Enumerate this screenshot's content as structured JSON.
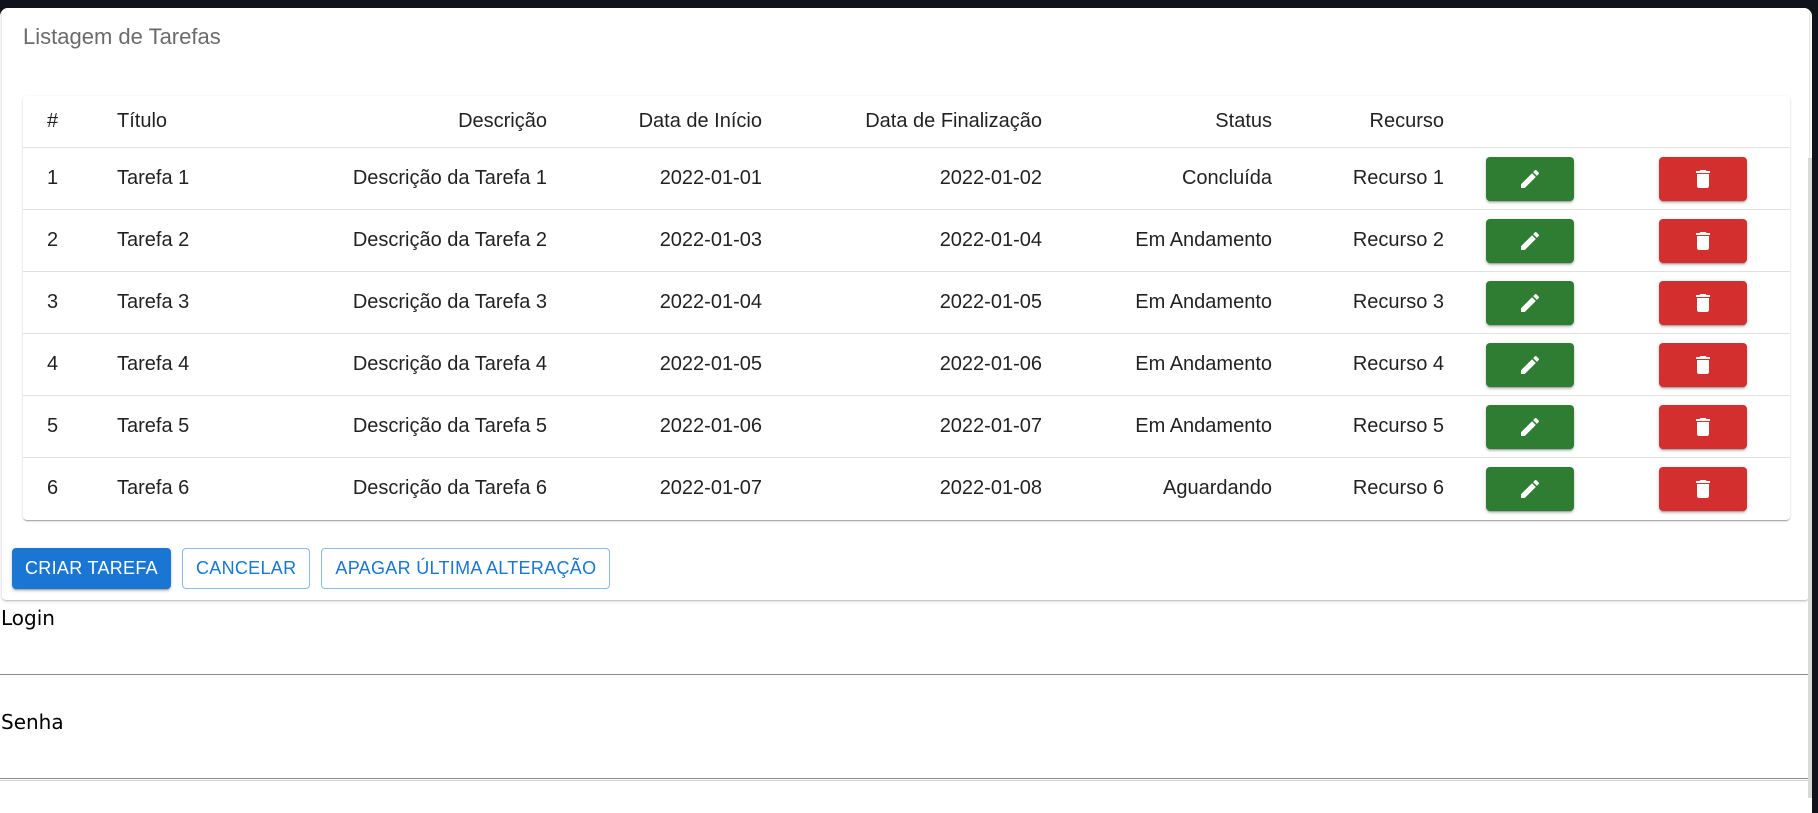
{
  "header": {
    "title": "Listagem de Tarefas"
  },
  "table": {
    "columns": [
      "#",
      "Título",
      "Descrição",
      "Data de Início",
      "Data de Finalização",
      "Status",
      "Recurso"
    ],
    "rows": [
      {
        "id": "1",
        "title": "Tarefa 1",
        "description": "Descrição da Tarefa 1",
        "start": "2022-01-01",
        "end": "2022-01-02",
        "status": "Concluída",
        "resource": "Recurso 1"
      },
      {
        "id": "2",
        "title": "Tarefa 2",
        "description": "Descrição da Tarefa 2",
        "start": "2022-01-03",
        "end": "2022-01-04",
        "status": "Em Andamento",
        "resource": "Recurso 2"
      },
      {
        "id": "3",
        "title": "Tarefa 3",
        "description": "Descrição da Tarefa 3",
        "start": "2022-01-04",
        "end": "2022-01-05",
        "status": "Em Andamento",
        "resource": "Recurso 3"
      },
      {
        "id": "4",
        "title": "Tarefa 4",
        "description": "Descrição da Tarefa 4",
        "start": "2022-01-05",
        "end": "2022-01-06",
        "status": "Em Andamento",
        "resource": "Recurso 4"
      },
      {
        "id": "5",
        "title": "Tarefa 5",
        "description": "Descrição da Tarefa 5",
        "start": "2022-01-06",
        "end": "2022-01-07",
        "status": "Em Andamento",
        "resource": "Recurso 5"
      },
      {
        "id": "6",
        "title": "Tarefa 6",
        "description": "Descrição da Tarefa 6",
        "start": "2022-01-07",
        "end": "2022-01-08",
        "status": "Aguardando",
        "resource": "Recurso 6"
      }
    ],
    "edit_icon": "pencil-icon",
    "delete_icon": "trash-icon"
  },
  "actions": {
    "create_label": "CRIAR TAREFA",
    "cancel_label": "CANCELAR",
    "undo_label": "APAGAR ÚLTIMA ALTERAÇÃO"
  },
  "form": {
    "login_label": "Login",
    "login_value": "",
    "password_label": "Senha",
    "password_value": ""
  },
  "colors": {
    "primary": "#1976d2",
    "edit": "#2e7d32",
    "delete": "#d32f2f"
  }
}
